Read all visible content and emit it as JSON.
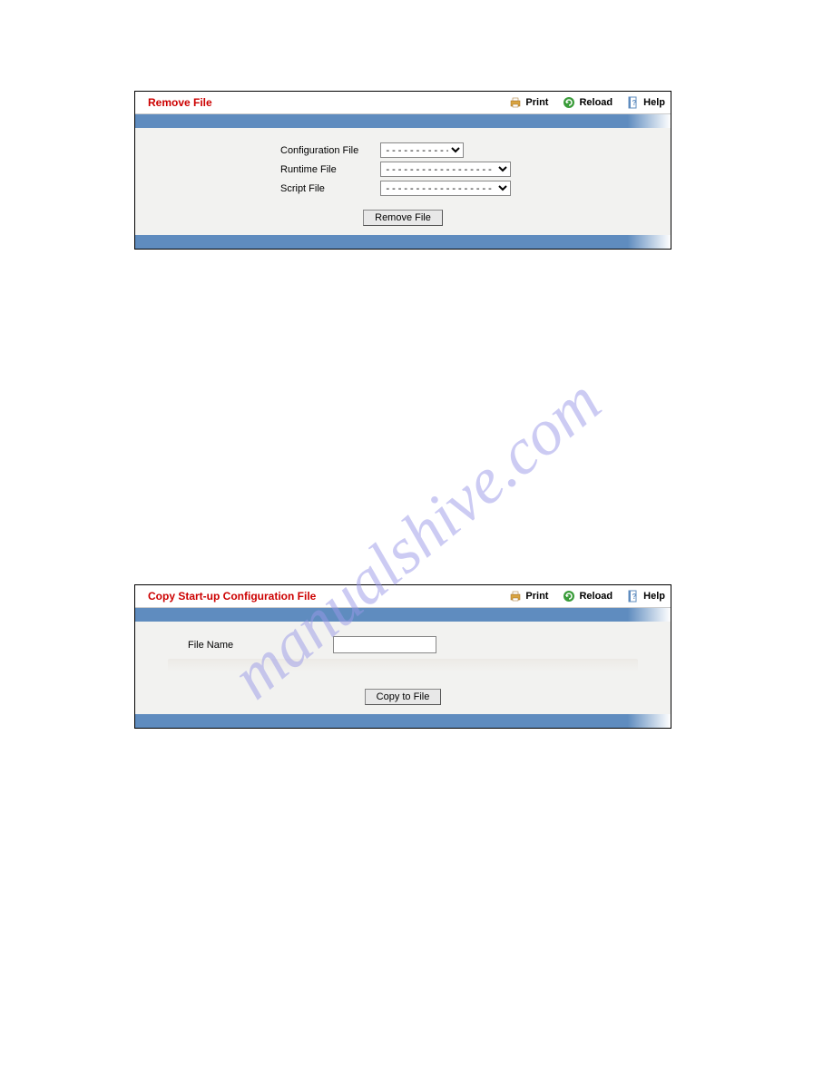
{
  "watermark": "manualshive.com",
  "header_links": {
    "print": "Print",
    "reload": "Reload",
    "help": "Help"
  },
  "panel1": {
    "title": "Remove File",
    "labels": {
      "config": "Configuration File",
      "runtime": "Runtime File",
      "script": "Script File"
    },
    "dash_option": "------------------",
    "button": "Remove File"
  },
  "panel2": {
    "title": "Copy Start-up Configuration File",
    "labels": {
      "filename": "File Name"
    },
    "filename_value": "",
    "button": "Copy to File"
  }
}
